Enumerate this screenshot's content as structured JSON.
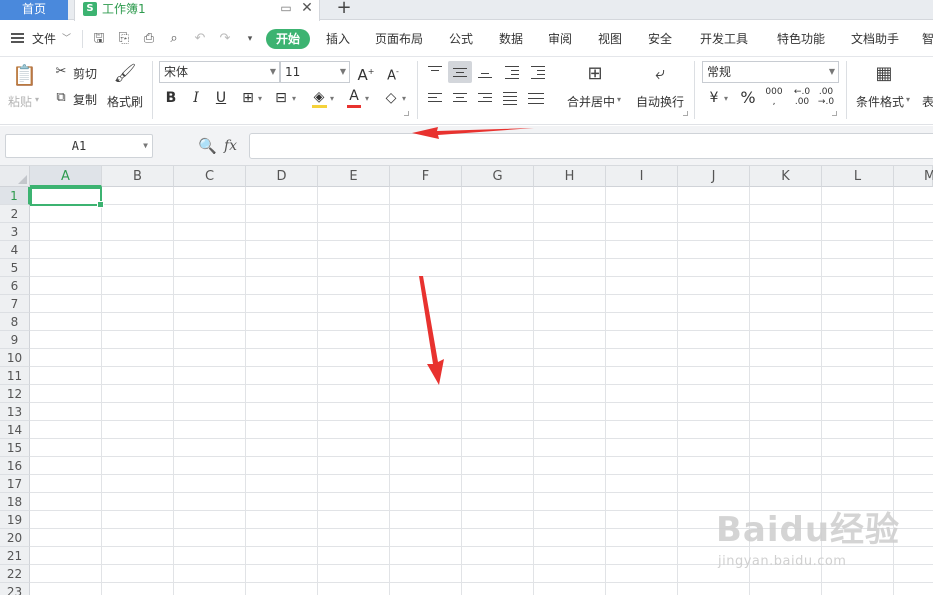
{
  "tabs": {
    "home": "首页",
    "workbook": "工作簿1",
    "workbook_badge": "S"
  },
  "menu": {
    "file": "文件",
    "items": [
      "开始",
      "插入",
      "页面布局",
      "公式",
      "数据",
      "审阅",
      "视图",
      "安全",
      "开发工具",
      "特色功能",
      "文档助手",
      "智"
    ]
  },
  "ribbon": {
    "paste": "粘贴",
    "cut": "剪切",
    "copy": "复制",
    "format_painter": "格式刷",
    "font_name": "宋体",
    "font_size": "11",
    "bold": "B",
    "italic": "I",
    "underline": "U",
    "merge_center": "合并居中",
    "wrap_text": "自动换行",
    "number_format": "常规",
    "percent": "%",
    "conditional_format": "条件格式",
    "table_style_partial": "表"
  },
  "formula_bar": {
    "name_box": "A1",
    "fx": "fx",
    "formula": ""
  },
  "sheet": {
    "columns": [
      "A",
      "B",
      "C",
      "D",
      "E",
      "F",
      "G",
      "H",
      "I",
      "J",
      "K",
      "L",
      "M"
    ],
    "rows": [
      "1",
      "2",
      "3",
      "4",
      "5",
      "6",
      "7",
      "8",
      "9",
      "10",
      "11",
      "12",
      "13",
      "14",
      "15",
      "16",
      "17",
      "18",
      "19",
      "20",
      "21",
      "22",
      "23"
    ],
    "active_cell": "A1"
  },
  "colors": {
    "accent_green": "#3cb371",
    "home_tab_blue": "#4a89dc",
    "annotation_red": "#e8322f"
  },
  "watermark": {
    "main": "Baidu经验",
    "sub": "jingyan.baidu.com"
  }
}
